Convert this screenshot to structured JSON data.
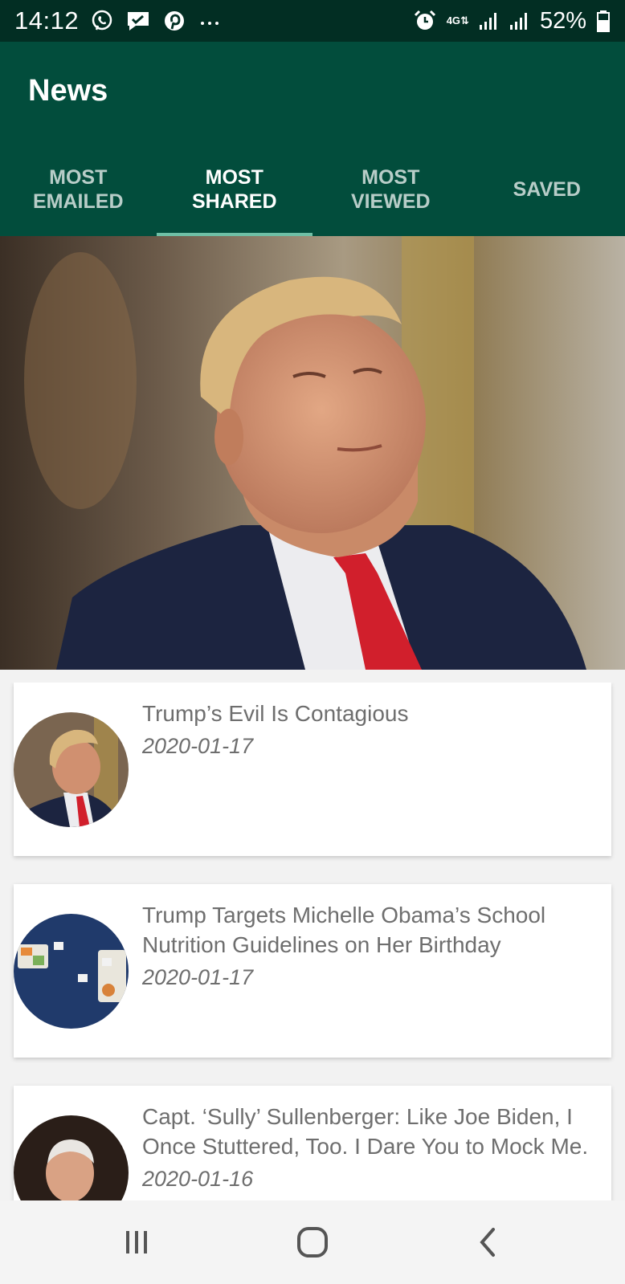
{
  "status_bar": {
    "time": "14:12",
    "network_type_top": "4G",
    "network_type_bottom": "⇅",
    "battery_percent": "52%",
    "notification_icons": [
      "viber-icon",
      "chat-icon",
      "pinterest-icon",
      "more-notifications-icon"
    ],
    "system_icons": [
      "alarm-icon",
      "network-4g-icon",
      "signal-icon",
      "signal-icon",
      "battery-icon"
    ]
  },
  "app_bar": {
    "title": "News"
  },
  "tabs": [
    {
      "label": "Most\nEmailed",
      "active": false
    },
    {
      "label": "Most\nShared",
      "active": true
    },
    {
      "label": "Most\nViewed",
      "active": false
    },
    {
      "label": "Saved",
      "active": false
    }
  ],
  "articles": [
    {
      "title": "Trump’s Evil Is Contagious",
      "date": "2020-01-17"
    },
    {
      "title": "Trump Targets Michelle Obama’s School Nutrition Guidelines on Her Birthday",
      "date": "2020-01-17"
    },
    {
      "title": "Capt. ‘Sully’ Sullenberger: Like Joe Biden, I Once Stuttered, Too. I Dare You to Mock Me.",
      "date": "2020-01-16"
    }
  ],
  "nav_bar": {
    "buttons": [
      "recent-apps-icon",
      "home-icon",
      "back-icon"
    ]
  },
  "colors": {
    "status_bar": "#022e23",
    "app_bar": "#024d3c",
    "tab_indicator": "#6fc0a6",
    "text_secondary": "#6e6e6e"
  }
}
